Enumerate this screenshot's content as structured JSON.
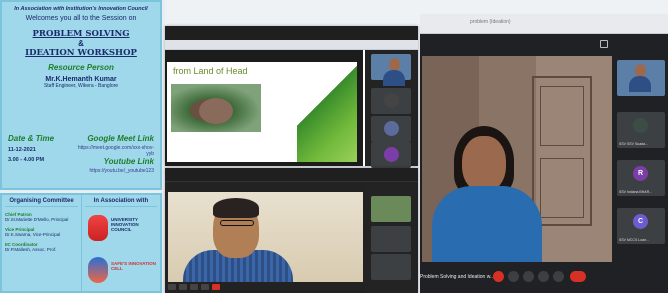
{
  "poster": {
    "association": "In Association with Institution's Innovation Council",
    "welcome": "Welcomes you all to the Session on",
    "title1": "PROBLEM SOLVING",
    "amp": "&",
    "title2": "IDEATION WORKSHOP",
    "resource_label": "Resource Person",
    "resource_name": "Mr.K.Hemanth Kumar",
    "resource_role": "Staff Engineer, Wikera - Banglore",
    "date_label": "Date & Time",
    "date_value": "11-12-2021",
    "time_value": "3.00 - 4.00 PM",
    "meet_label": "Google Meet Link",
    "meet_link": "https://meet.google.com/xxx-shov-yyb",
    "youtube_label": "Youtube Link",
    "youtube_link": "https://youtu.be/_youtube123",
    "organizing_title": "Organising Committee",
    "association_title": "In Association with",
    "org_line1": "Chief Patron",
    "org_line1b": "Dr.Sr.Mariette D'Mello, Principal",
    "org_line2": "Vice Principal",
    "org_line2b": "Dr.K.Swarna, Vice-Principal",
    "org_line3": "IIC Coordinator",
    "org_line3b": "Dr.P.Mallesh, Assoc. Prof.",
    "assoc1": "UNIVERSITY INNOVATION COUNCIL",
    "assoc2": "SAFE'S INNOVATION CELL"
  },
  "window1": {
    "slide_title": "from Land of Head"
  },
  "window3": {
    "tab_title": "problem (Ideation)",
    "meeting_title": "Problem Solving and Ideation w...",
    "tiles": [
      {
        "initial": "",
        "label": "Resource person"
      },
      {
        "initial": "",
        "label": "SSV SSV Suada..."
      },
      {
        "initial": "R",
        "label": "SSV Indiana BHAR..."
      },
      {
        "initial": "C",
        "label": "SSV MCCS Loan..."
      }
    ]
  },
  "colors": {
    "poster_bg": "#9fd8ea",
    "meet_red": "#d93025",
    "slide_green": "#3a8c2c"
  }
}
